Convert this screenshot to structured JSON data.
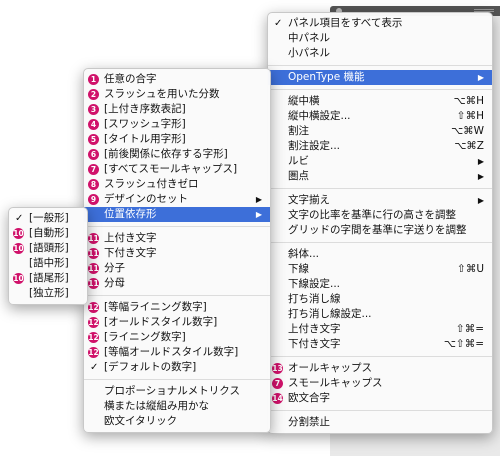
{
  "main_menu": {
    "items": [
      {
        "label": "パネル項目をすべて表示",
        "checked": true
      },
      {
        "label": "中パネル"
      },
      {
        "label": "小パネル"
      },
      {
        "label": "OpenType 機能",
        "submenu": true,
        "highlighted": true
      },
      {
        "label": "縦中横",
        "shortcut": "⌥⌘H"
      },
      {
        "label": "縦中横設定...",
        "shortcut": "⇧⌘H"
      },
      {
        "label": "割注",
        "shortcut": "⌥⌘W"
      },
      {
        "label": "割注設定...",
        "shortcut": "⌥⌘Z"
      },
      {
        "label": "ルビ",
        "submenu": true
      },
      {
        "label": "圏点",
        "submenu": true
      },
      {
        "label": "文字揃え",
        "submenu": true
      },
      {
        "label": "文字の比率を基準に行の高さを調整"
      },
      {
        "label": "グリッドの字間を基準に字送りを調整"
      },
      {
        "label": "斜体..."
      },
      {
        "label": "下線",
        "shortcut": "⇧⌘U"
      },
      {
        "label": "下線設定..."
      },
      {
        "label": "打ち消し線"
      },
      {
        "label": "打ち消し線設定..."
      },
      {
        "label": "上付き文字",
        "shortcut": "⇧⌘="
      },
      {
        "label": "下付き文字",
        "shortcut": "⌥⇧⌘="
      },
      {
        "label": "オールキャップス",
        "badge": "13"
      },
      {
        "label": "スモールキャップス",
        "badge": "7"
      },
      {
        "label": "欧文合字",
        "badge": "14"
      },
      {
        "label": "分割禁止"
      }
    ]
  },
  "opentype_menu": {
    "items": [
      {
        "label": "任意の合字",
        "badge": "1"
      },
      {
        "label": "スラッシュを用いた分数",
        "badge": "2"
      },
      {
        "label": "[上付き序数表記]",
        "badge": "3"
      },
      {
        "label": "[スワッシュ字形]",
        "badge": "4"
      },
      {
        "label": "[タイトル用字形]",
        "badge": "5"
      },
      {
        "label": "[前後関係に依存する字形]",
        "badge": "6"
      },
      {
        "label": "[すべてスモールキャップス]",
        "badge": "7"
      },
      {
        "label": "スラッシュ付きゼロ",
        "badge": "8"
      },
      {
        "label": "デザインのセット",
        "badge": "9",
        "submenu": true
      },
      {
        "label": "位置依存形",
        "submenu": true,
        "highlighted": true
      },
      {
        "label": "上付き文字",
        "badge": "11"
      },
      {
        "label": "下付き文字",
        "badge": "11"
      },
      {
        "label": "分子",
        "badge": "11"
      },
      {
        "label": "分母",
        "badge": "11"
      },
      {
        "label": "[等幅ライニング数字]",
        "badge": "12"
      },
      {
        "label": "[オールドスタイル数字]",
        "badge": "12"
      },
      {
        "label": "[ライニング数字]",
        "badge": "12"
      },
      {
        "label": "[等幅オールドスタイル数字]",
        "badge": "12"
      },
      {
        "label": "[デフォルトの数字]",
        "checked": true
      },
      {
        "label": "プロポーショナルメトリクス"
      },
      {
        "label": "横または縦組み用かな"
      },
      {
        "label": "欧文イタリック"
      }
    ]
  },
  "position_menu": {
    "items": [
      {
        "label": "[一般形]",
        "checked": true
      },
      {
        "label": "[自動形]",
        "badge": "10"
      },
      {
        "label": "[語頭形]",
        "badge": "10"
      },
      {
        "label": "[語中形]"
      },
      {
        "label": "[語尾形]",
        "badge": "10"
      },
      {
        "label": "[独立形]"
      }
    ]
  },
  "glyphs": {
    "check": "✓",
    "arrow": "▶"
  },
  "colors": {
    "highlight": "#3d6fd9",
    "badge": "#d0126a"
  }
}
